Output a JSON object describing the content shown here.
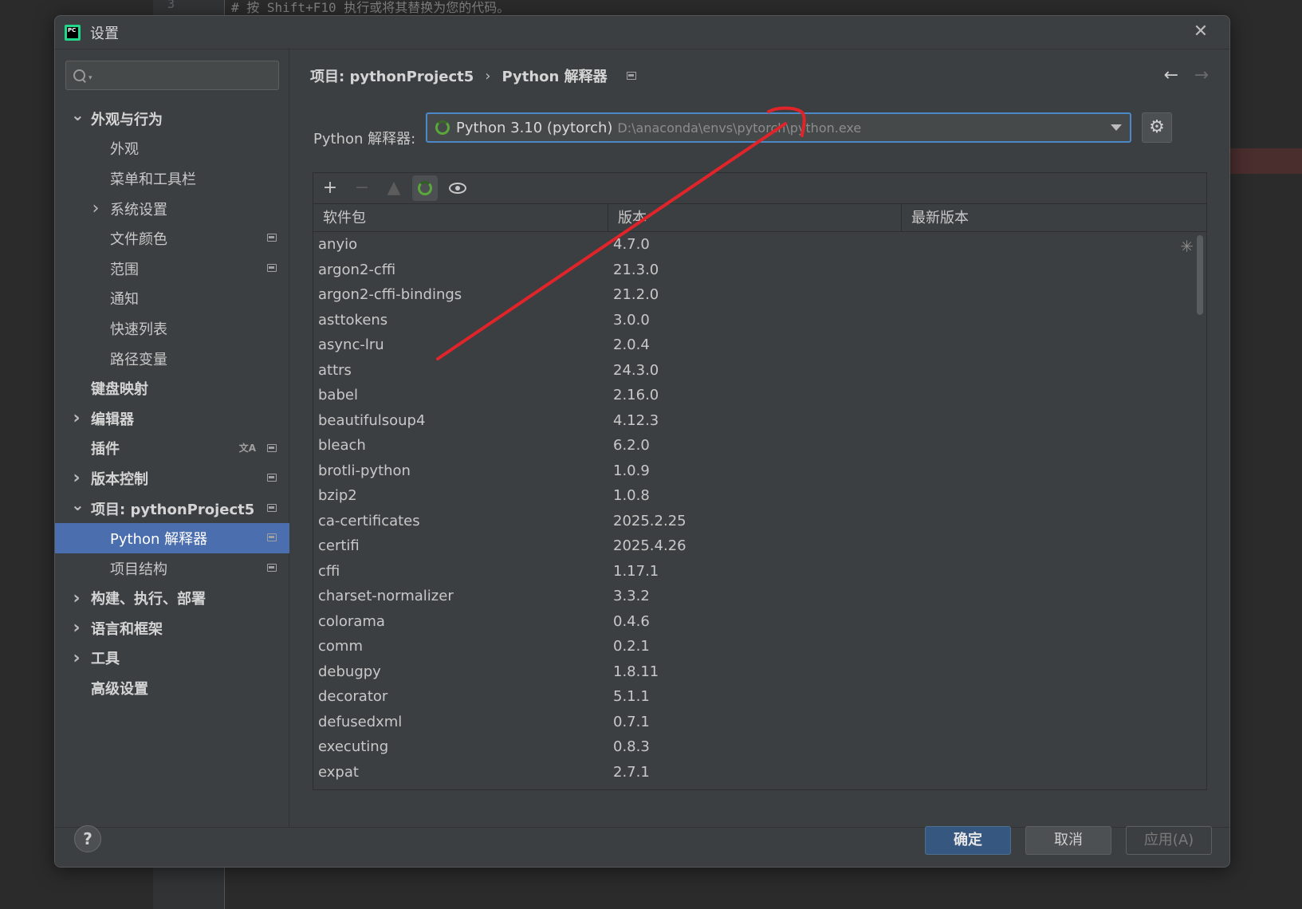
{
  "background": {
    "line_number": "3",
    "code_line": "# 按 Shift+F10 执行或将其替换为您的代码。"
  },
  "dialog": {
    "title": "设置",
    "logo_text": "PC",
    "close_icon": "close-icon"
  },
  "sidebar": {
    "search": {
      "value": "",
      "placeholder": ""
    },
    "items": [
      {
        "label": "外观与行为",
        "bold": true,
        "chevron": "down"
      },
      {
        "label": "外观"
      },
      {
        "label": "菜单和工具栏"
      },
      {
        "label": "系统设置",
        "chevron": "right"
      },
      {
        "label": "文件颜色",
        "icon": "settings-scope-icon"
      },
      {
        "label": "范围",
        "icon": "settings-scope-icon"
      },
      {
        "label": "通知"
      },
      {
        "label": "快速列表"
      },
      {
        "label": "路径变量"
      },
      {
        "label": "键盘映射",
        "bold": true
      },
      {
        "label": "编辑器",
        "bold": true,
        "chevron": "right"
      },
      {
        "label": "插件",
        "bold": true,
        "icon": "settings-scope-icon",
        "icon2": "translate-icon"
      },
      {
        "label": "版本控制",
        "bold": true,
        "chevron": "right",
        "icon": "settings-scope-icon"
      },
      {
        "label": "项目: pythonProject5",
        "bold": true,
        "chevron": "down",
        "icon": "settings-scope-icon"
      },
      {
        "label": "Python 解释器",
        "selected": true,
        "icon": "settings-scope-icon"
      },
      {
        "label": "项目结构",
        "icon": "settings-scope-icon"
      },
      {
        "label": "构建、执行、部署",
        "bold": true,
        "chevron": "right"
      },
      {
        "label": "语言和框架",
        "bold": true,
        "chevron": "right"
      },
      {
        "label": "工具",
        "bold": true,
        "chevron": "right"
      },
      {
        "label": "高级设置",
        "bold": true
      }
    ]
  },
  "breadcrumb": {
    "project": "项目: pythonProject5",
    "separator": "›",
    "page": "Python 解释器"
  },
  "interpreter": {
    "label": "Python 解释器:",
    "name": "Python 3.10 (pytorch)",
    "path": "D:\\anaconda\\envs\\pytorch\\python.exe"
  },
  "table": {
    "headers": [
      "软件包",
      "版本",
      "最新版本"
    ],
    "rows": [
      [
        "anyio",
        "4.7.0"
      ],
      [
        "argon2-cffi",
        "21.3.0"
      ],
      [
        "argon2-cffi-bindings",
        "21.2.0"
      ],
      [
        "asttokens",
        "3.0.0"
      ],
      [
        "async-lru",
        "2.0.4"
      ],
      [
        "attrs",
        "24.3.0"
      ],
      [
        "babel",
        "2.16.0"
      ],
      [
        "beautifulsoup4",
        "4.12.3"
      ],
      [
        "bleach",
        "6.2.0"
      ],
      [
        "brotli-python",
        "1.0.9"
      ],
      [
        "bzip2",
        "1.0.8"
      ],
      [
        "ca-certificates",
        "2025.2.25"
      ],
      [
        "certifi",
        "2025.4.26"
      ],
      [
        "cffi",
        "1.17.1"
      ],
      [
        "charset-normalizer",
        "3.3.2"
      ],
      [
        "colorama",
        "0.4.6"
      ],
      [
        "comm",
        "0.2.1"
      ],
      [
        "debugpy",
        "1.8.11"
      ],
      [
        "decorator",
        "5.1.1"
      ],
      [
        "defusedxml",
        "0.7.1"
      ],
      [
        "executing",
        "0.8.3"
      ],
      [
        "expat",
        "2.7.1"
      ]
    ]
  },
  "footer": {
    "help": "?",
    "ok": "确定",
    "cancel": "取消",
    "apply": "应用(A)"
  },
  "colors": {
    "selection": "#4b6eaf",
    "focus_border": "#4a88c7",
    "annotation_red": "#e0242a"
  }
}
